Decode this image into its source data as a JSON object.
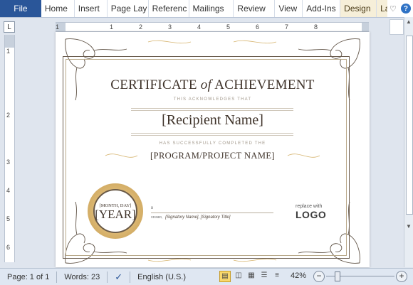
{
  "ribbon": {
    "file": "File",
    "tabs": [
      "Home",
      "Insert",
      "Page Lay",
      "Referenc",
      "Mailings",
      "Review",
      "View",
      "Add-Ins",
      "Design",
      "Layout"
    ]
  },
  "ruler": {
    "corner": "L",
    "h_numbers": [
      "1",
      "1",
      "2",
      "3",
      "4",
      "5",
      "6",
      "7",
      "8"
    ],
    "v_numbers": [
      "1",
      "2",
      "3",
      "4",
      "5",
      "6"
    ]
  },
  "certificate": {
    "title_a": "CERTIFICATE",
    "title_of": "of",
    "title_b": "ACHIEVEMENT",
    "acknowledges": "THIS ACKNOWLEDGES THAT",
    "recipient": "[Recipient Name]",
    "completed": "HAS SUCCESSFULLY COMPLETED THE",
    "program": "[PROGRAM/PROJECT NAME]",
    "seal_date": "[MONTH, DAY]",
    "seal_year": "[YEAR]",
    "sig_mark": "x",
    "sig_prefix": "sɪɢɴᴇᴅ,",
    "signatory": "[Signatory Name], [Signatory Title]",
    "replace_with": "replace with",
    "logo": "LOGO"
  },
  "status": {
    "page": "Page: 1 of 1",
    "words": "Words: 23",
    "language": "English (U.S.)",
    "zoom": "42%",
    "zoom_level_percent": 42
  },
  "colors": {
    "file_tab": "#2a5699",
    "contextual_tab": "#f6efd9",
    "seal_gold": "#d9b46e",
    "ink": "#3e3229"
  }
}
